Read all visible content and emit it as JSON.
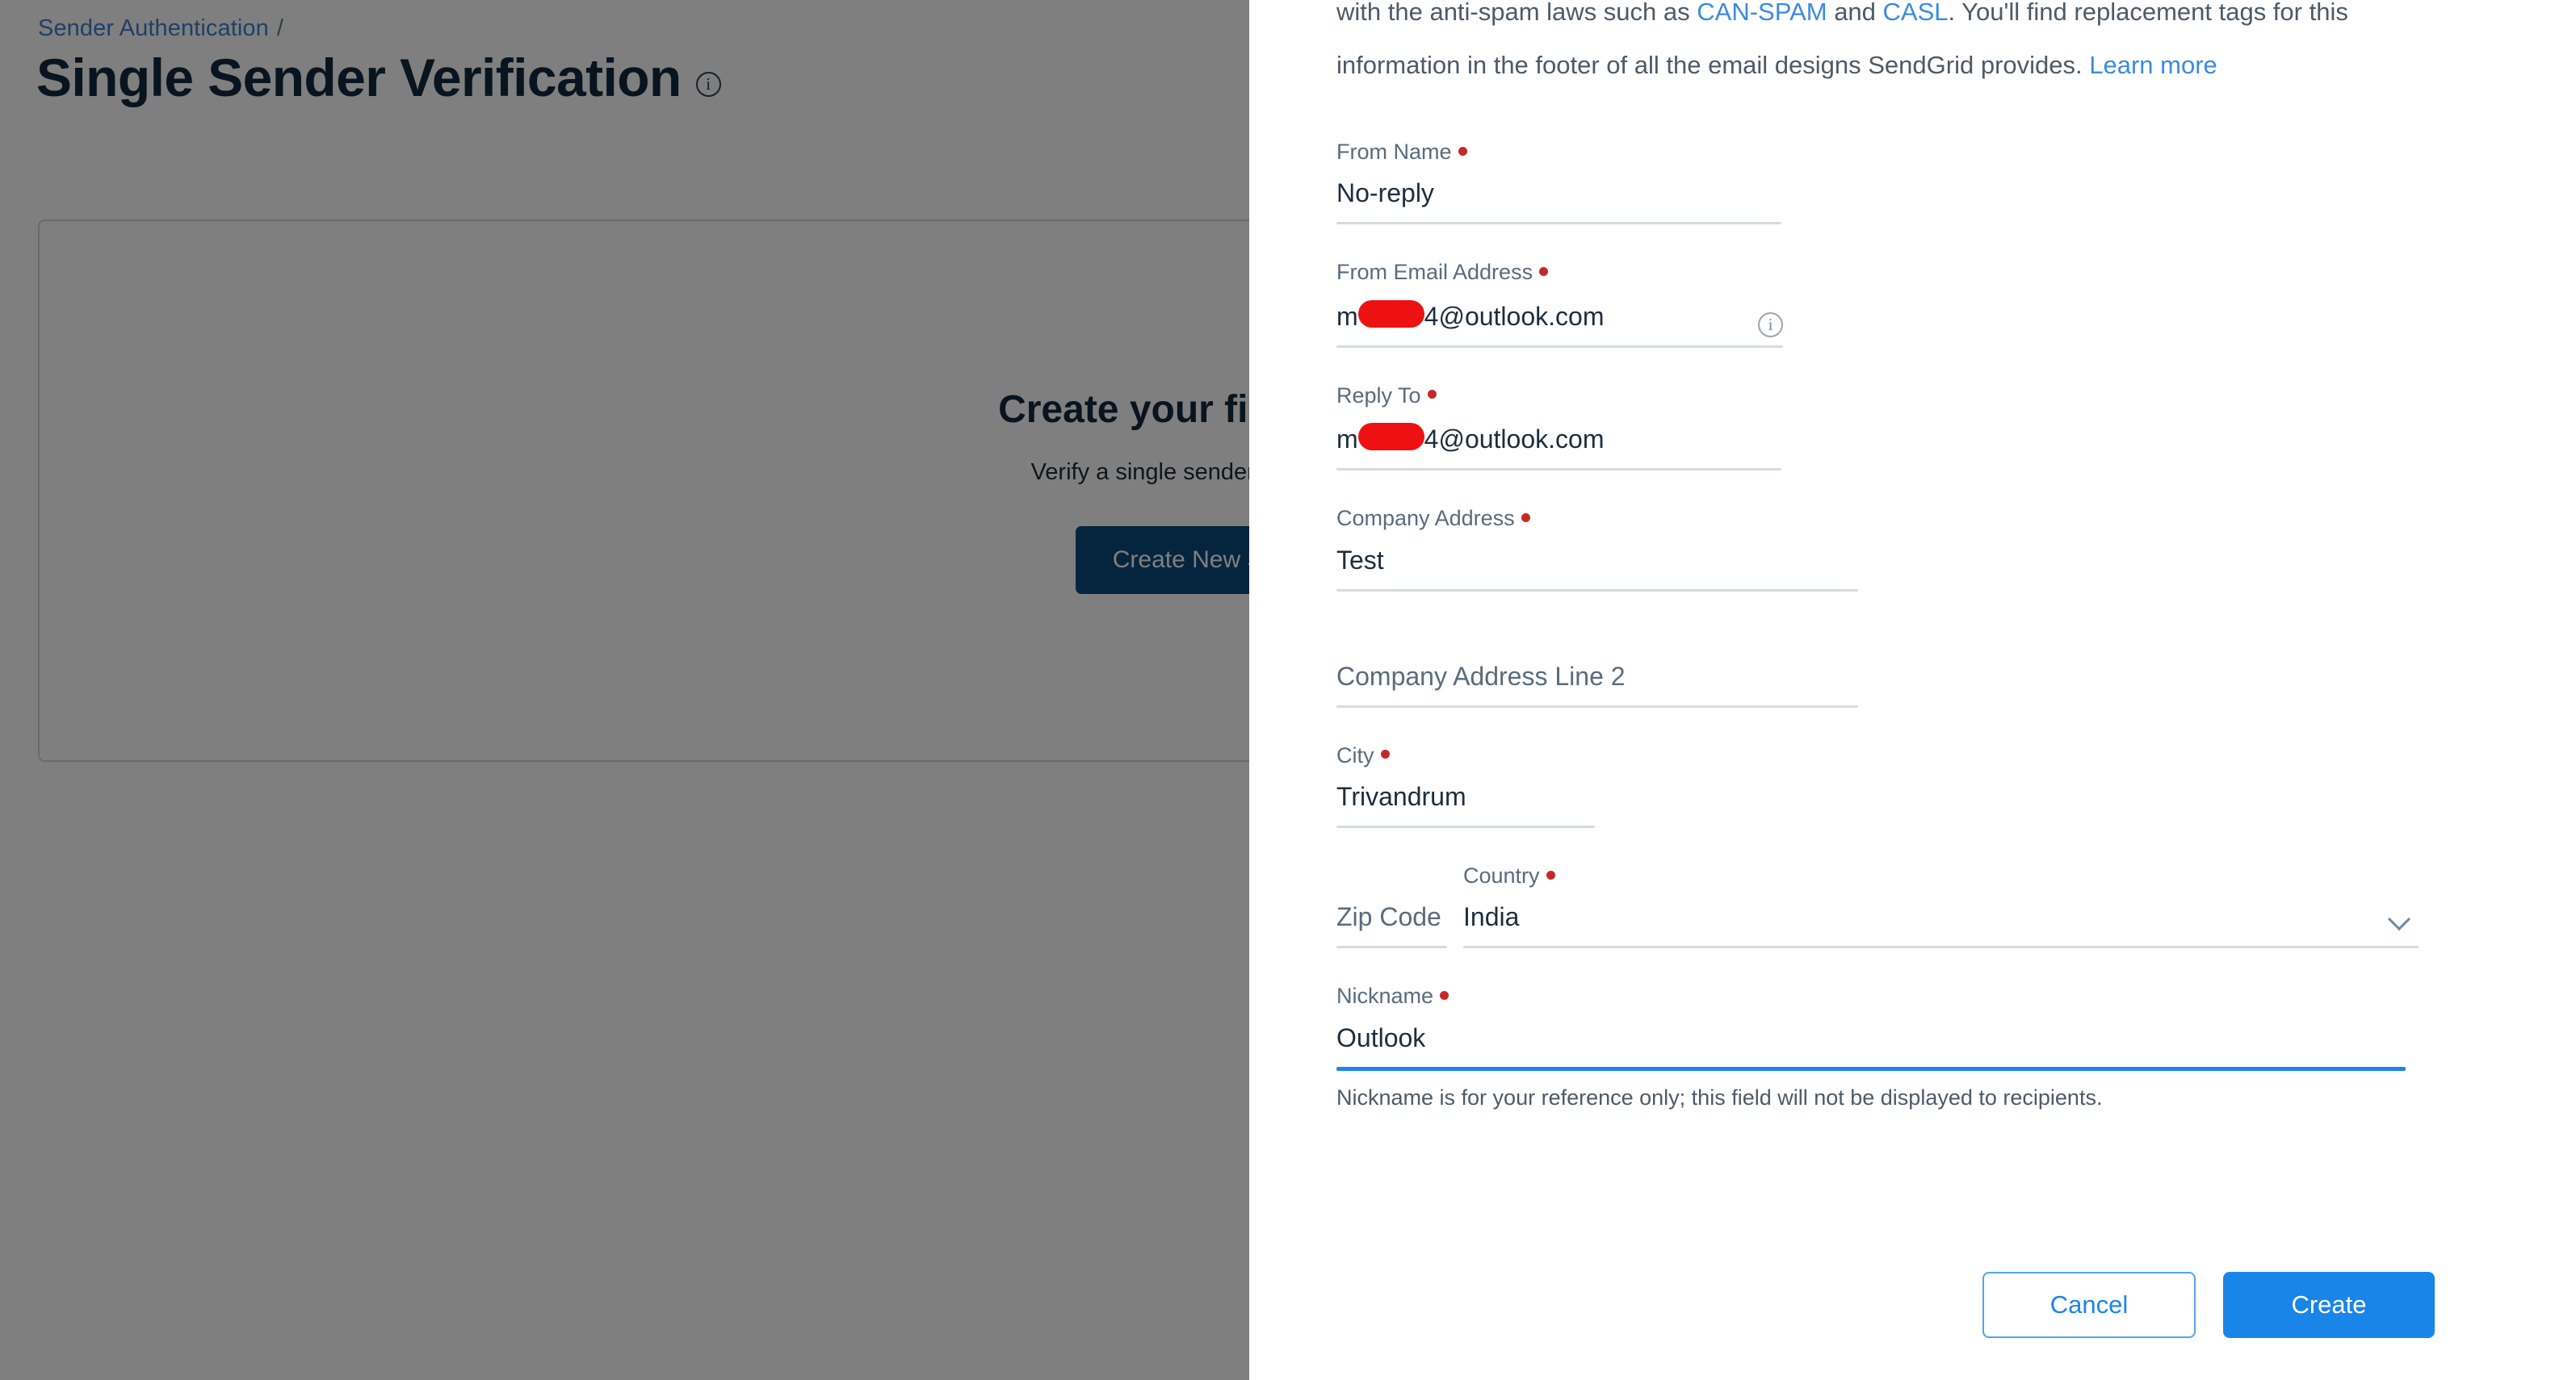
{
  "background": {
    "breadcrumb": {
      "link": "Sender Authentication",
      "separator": "/"
    },
    "page_title": "Single Sender Verification",
    "title_info_icon": "i",
    "empty_state": {
      "title": "Create your first Sender",
      "subtitle": "Verify a single sender email address",
      "button_label": "Create New Sender"
    }
  },
  "modal": {
    "intro": {
      "line1_pre": "with the anti-spam laws such as ",
      "link_can_spam": "CAN-SPAM",
      "line1_mid": " and ",
      "link_casl": "CASL",
      "line1_post": ". You'll find replacement tags for this information in the footer of all the email designs SendGrid provides. ",
      "link_learn_more": "Learn more"
    },
    "fields": {
      "from_name": {
        "label": "From Name",
        "required": true,
        "value": "No-reply"
      },
      "from_email": {
        "label": "From Email Address",
        "required": true,
        "value_prefix": "m",
        "value_redacted": true,
        "value_suffix": "4@outlook.com",
        "info_icon": "i"
      },
      "reply_to": {
        "label": "Reply To",
        "required": true,
        "value_prefix": "m",
        "value_redacted": true,
        "value_suffix": "4@outlook.com"
      },
      "company_address": {
        "label": "Company Address",
        "required": true,
        "value": "Test"
      },
      "company_address_2": {
        "placeholder": "Company Address Line 2",
        "required": false,
        "value": ""
      },
      "city": {
        "label": "City",
        "required": true,
        "value": "Trivandrum"
      },
      "zip_code": {
        "placeholder": "Zip Code",
        "required": false,
        "value": ""
      },
      "country": {
        "label": "Country",
        "required": true,
        "value": "India",
        "chevron": "chevron-down"
      },
      "nickname": {
        "label": "Nickname",
        "required": true,
        "value": "Outlook",
        "focused": true,
        "helper": "Nickname is for your reference only; this field will not be displayed to recipients."
      }
    },
    "footer": {
      "cancel_label": "Cancel",
      "create_label": "Create"
    }
  },
  "colors": {
    "accent_blue": "#1a85e8",
    "link_blue": "#3b8ae5",
    "title_dark": "#10293f",
    "required_red": "#c62828",
    "redaction_red": "#ee1111",
    "primary_button_bg": "#0b4a7f",
    "underline_grey": "#d6dbe0"
  }
}
